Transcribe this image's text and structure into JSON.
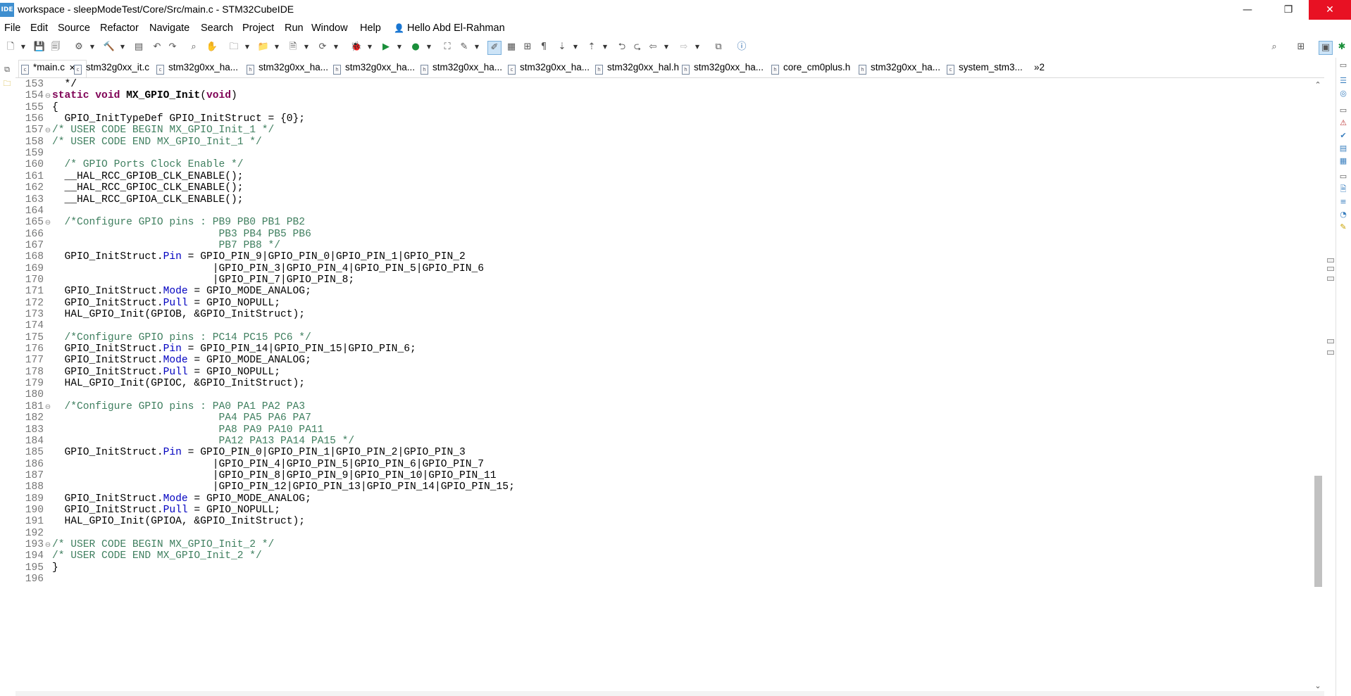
{
  "window": {
    "title": "workspace - sleepModeTest/Core/Src/main.c - STM32CubeIDE",
    "app_icon_label": "IDE",
    "minimize_glyph": "—",
    "restore_glyph": "❐",
    "close_glyph": "✕"
  },
  "menu": [
    {
      "label": "File"
    },
    {
      "label": "Edit"
    },
    {
      "label": "Source"
    },
    {
      "label": "Refactor"
    },
    {
      "label": "Navigate"
    },
    {
      "label": "Search"
    },
    {
      "label": "Project"
    },
    {
      "label": "Run"
    },
    {
      "label": "Window"
    },
    {
      "label": "Help"
    },
    {
      "label": "Hello Abd El-Rahman"
    }
  ],
  "user_icon_glyph": "👤",
  "tabs": [
    {
      "label": "*main.c",
      "icon": "c-source-icon",
      "icon_text": "c",
      "close": "✕",
      "active": true
    },
    {
      "label": "stm32g0xx_it.c",
      "icon": "c-source-icon",
      "icon_text": "c"
    },
    {
      "label": "stm32g0xx_ha...",
      "icon": "c-source-icon",
      "icon_text": "c"
    },
    {
      "label": "stm32g0xx_ha...",
      "icon": "h-header-icon",
      "icon_text": "h"
    },
    {
      "label": "stm32g0xx_ha...",
      "icon": "h-header-icon",
      "icon_text": "h"
    },
    {
      "label": "stm32g0xx_ha...",
      "icon": "h-header-icon",
      "icon_text": "h"
    },
    {
      "label": "stm32g0xx_ha...",
      "icon": "c-source-icon",
      "icon_text": "c"
    },
    {
      "label": "stm32g0xx_hal.h",
      "icon": "h-header-icon",
      "icon_text": "h"
    },
    {
      "label": "stm32g0xx_ha...",
      "icon": "h-header-icon",
      "icon_text": "h"
    },
    {
      "label": "core_cm0plus.h",
      "icon": "h-header-icon",
      "icon_text": "h"
    },
    {
      "label": "stm32g0xx_ha...",
      "icon": "h-header-icon",
      "icon_text": "h"
    },
    {
      "label": "system_stm3...",
      "icon": "c-source-icon",
      "icon_text": "c"
    },
    {
      "label": "»2",
      "icon": "more-tabs-icon",
      "icon_text": ""
    }
  ],
  "editor": {
    "lines": [
      {
        "n": "153",
        "fold": "",
        "parts": [
          [
            "t",
            "  */"
          ]
        ]
      },
      {
        "n": "154",
        "fold": "⊖",
        "parts": [
          [
            "kw",
            "static void "
          ],
          [
            "fn",
            "MX_GPIO_Init"
          ],
          [
            "t",
            "("
          ],
          [
            "kw",
            "void"
          ],
          [
            "t",
            ")"
          ]
        ]
      },
      {
        "n": "155",
        "fold": "",
        "parts": [
          [
            "t",
            "{"
          ]
        ]
      },
      {
        "n": "156",
        "fold": "",
        "parts": [
          [
            "t",
            "  GPIO_InitTypeDef GPIO_InitStruct = {0};"
          ]
        ]
      },
      {
        "n": "157",
        "fold": "⊖",
        "parts": [
          [
            "cm",
            "/* USER CODE BEGIN MX_GPIO_Init_1 */"
          ]
        ]
      },
      {
        "n": "158",
        "fold": "",
        "parts": [
          [
            "cm",
            "/* USER CODE END MX_GPIO_Init_1 */"
          ]
        ]
      },
      {
        "n": "159",
        "fold": "",
        "parts": [
          [
            "t",
            ""
          ]
        ]
      },
      {
        "n": "160",
        "fold": "",
        "parts": [
          [
            "cm",
            "  /* GPIO Ports Clock Enable */"
          ]
        ]
      },
      {
        "n": "161",
        "fold": "",
        "parts": [
          [
            "t",
            "  __HAL_RCC_GPIOB_CLK_ENABLE();"
          ]
        ]
      },
      {
        "n": "162",
        "fold": "",
        "parts": [
          [
            "t",
            "  __HAL_RCC_GPIOC_CLK_ENABLE();"
          ]
        ]
      },
      {
        "n": "163",
        "fold": "",
        "parts": [
          [
            "t",
            "  __HAL_RCC_GPIOA_CLK_ENABLE();"
          ]
        ]
      },
      {
        "n": "164",
        "fold": "",
        "parts": [
          [
            "t",
            ""
          ]
        ]
      },
      {
        "n": "165",
        "fold": "⊖",
        "parts": [
          [
            "cm",
            "  /*Configure GPIO pins : PB9 PB0 PB1 PB2"
          ]
        ]
      },
      {
        "n": "166",
        "fold": "",
        "parts": [
          [
            "cm",
            "                           PB3 PB4 PB5 PB6"
          ]
        ]
      },
      {
        "n": "167",
        "fold": "",
        "parts": [
          [
            "cm",
            "                           PB7 PB8 */"
          ]
        ]
      },
      {
        "n": "168",
        "fold": "",
        "parts": [
          [
            "t",
            "  GPIO_InitStruct."
          ],
          [
            "fd",
            "Pin"
          ],
          [
            "t",
            " = GPIO_PIN_9|GPIO_PIN_0|GPIO_PIN_1|GPIO_PIN_2"
          ]
        ]
      },
      {
        "n": "169",
        "fold": "",
        "parts": [
          [
            "t",
            "                          |GPIO_PIN_3|GPIO_PIN_4|GPIO_PIN_5|GPIO_PIN_6"
          ]
        ]
      },
      {
        "n": "170",
        "fold": "",
        "parts": [
          [
            "t",
            "                          |GPIO_PIN_7|GPIO_PIN_8;"
          ]
        ]
      },
      {
        "n": "171",
        "fold": "",
        "parts": [
          [
            "t",
            "  GPIO_InitStruct."
          ],
          [
            "fd",
            "Mode"
          ],
          [
            "t",
            " = GPIO_MODE_ANALOG;"
          ]
        ]
      },
      {
        "n": "172",
        "fold": "",
        "parts": [
          [
            "t",
            "  GPIO_InitStruct."
          ],
          [
            "fd",
            "Pull"
          ],
          [
            "t",
            " = GPIO_NOPULL;"
          ]
        ]
      },
      {
        "n": "173",
        "fold": "",
        "parts": [
          [
            "t",
            "  HAL_GPIO_Init(GPIOB, &GPIO_InitStruct);"
          ]
        ]
      },
      {
        "n": "174",
        "fold": "",
        "parts": [
          [
            "t",
            ""
          ]
        ]
      },
      {
        "n": "175",
        "fold": "",
        "parts": [
          [
            "cm",
            "  /*Configure GPIO pins : PC14 PC15 PC6 */"
          ]
        ]
      },
      {
        "n": "176",
        "fold": "",
        "parts": [
          [
            "t",
            "  GPIO_InitStruct."
          ],
          [
            "fd",
            "Pin"
          ],
          [
            "t",
            " = GPIO_PIN_14|GPIO_PIN_15|GPIO_PIN_6;"
          ]
        ]
      },
      {
        "n": "177",
        "fold": "",
        "parts": [
          [
            "t",
            "  GPIO_InitStruct."
          ],
          [
            "fd",
            "Mode"
          ],
          [
            "t",
            " = GPIO_MODE_ANALOG;"
          ]
        ]
      },
      {
        "n": "178",
        "fold": "",
        "parts": [
          [
            "t",
            "  GPIO_InitStruct."
          ],
          [
            "fd",
            "Pull"
          ],
          [
            "t",
            " = GPIO_NOPULL;"
          ]
        ]
      },
      {
        "n": "179",
        "fold": "",
        "parts": [
          [
            "t",
            "  HAL_GPIO_Init(GPIOC, &GPIO_InitStruct);"
          ]
        ]
      },
      {
        "n": "180",
        "fold": "",
        "parts": [
          [
            "t",
            ""
          ]
        ]
      },
      {
        "n": "181",
        "fold": "⊖",
        "parts": [
          [
            "cm",
            "  /*Configure GPIO pins : PA0 PA1 PA2 PA3"
          ]
        ]
      },
      {
        "n": "182",
        "fold": "",
        "parts": [
          [
            "cm",
            "                           PA4 PA5 PA6 PA7"
          ]
        ]
      },
      {
        "n": "183",
        "fold": "",
        "parts": [
          [
            "cm",
            "                           PA8 PA9 PA10 PA11"
          ]
        ]
      },
      {
        "n": "184",
        "fold": "",
        "parts": [
          [
            "cm",
            "                           PA12 PA13 PA14 PA15 */"
          ]
        ]
      },
      {
        "n": "185",
        "fold": "",
        "parts": [
          [
            "t",
            "  GPIO_InitStruct."
          ],
          [
            "fd",
            "Pin"
          ],
          [
            "t",
            " = GPIO_PIN_0|GPIO_PIN_1|GPIO_PIN_2|GPIO_PIN_3"
          ]
        ]
      },
      {
        "n": "186",
        "fold": "",
        "parts": [
          [
            "t",
            "                          |GPIO_PIN_4|GPIO_PIN_5|GPIO_PIN_6|GPIO_PIN_7"
          ]
        ]
      },
      {
        "n": "187",
        "fold": "",
        "parts": [
          [
            "t",
            "                          |GPIO_PIN_8|GPIO_PIN_9|GPIO_PIN_10|GPIO_PIN_11"
          ]
        ]
      },
      {
        "n": "188",
        "fold": "",
        "parts": [
          [
            "t",
            "                          |GPIO_PIN_12|GPIO_PIN_13|GPIO_PIN_14|GPIO_PIN_15;"
          ]
        ]
      },
      {
        "n": "189",
        "fold": "",
        "parts": [
          [
            "t",
            "  GPIO_InitStruct."
          ],
          [
            "fd",
            "Mode"
          ],
          [
            "t",
            " = GPIO_MODE_ANALOG;"
          ]
        ]
      },
      {
        "n": "190",
        "fold": "",
        "parts": [
          [
            "t",
            "  GPIO_InitStruct."
          ],
          [
            "fd",
            "Pull"
          ],
          [
            "t",
            " = GPIO_NOPULL;"
          ]
        ]
      },
      {
        "n": "191",
        "fold": "",
        "parts": [
          [
            "t",
            "  HAL_GPIO_Init(GPIOA, &GPIO_InitStruct);"
          ]
        ]
      },
      {
        "n": "192",
        "fold": "",
        "parts": [
          [
            "t",
            ""
          ]
        ]
      },
      {
        "n": "193",
        "fold": "⊖",
        "parts": [
          [
            "cm",
            "/* USER CODE BEGIN MX_GPIO_Init_2 */"
          ]
        ]
      },
      {
        "n": "194",
        "fold": "",
        "parts": [
          [
            "cm",
            "/* USER CODE END MX_GPIO_Init_2 */"
          ]
        ]
      },
      {
        "n": "195",
        "fold": "",
        "parts": [
          [
            "t",
            "}"
          ]
        ]
      },
      {
        "n": "196",
        "fold": "",
        "parts": [
          [
            "t",
            ""
          ]
        ]
      }
    ]
  },
  "scroll": {
    "up": "⌃",
    "down": "⌄",
    "position": 0.64
  },
  "colors": {
    "keyword": "#7f0055",
    "comment": "#3f7f5f",
    "field": "#0000c0",
    "close_button": "#e81123",
    "accent": "#3a7fbf"
  }
}
